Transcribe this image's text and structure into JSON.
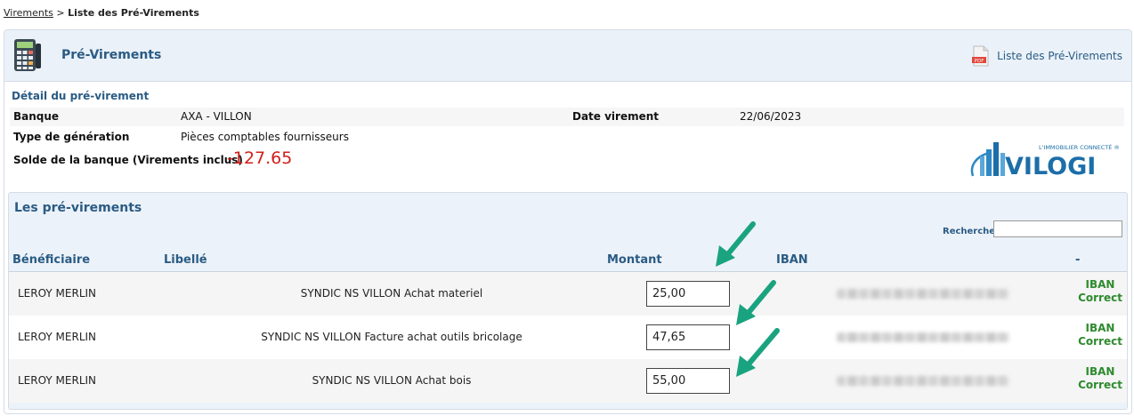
{
  "breadcrumb": {
    "parent": "Virements",
    "separator": ">",
    "current": "Liste des Pré-Virements"
  },
  "header": {
    "title": "Pré-Virements",
    "pdf_link": "Liste des Pré-Virements",
    "pdf_badge": "PDF"
  },
  "detail": {
    "section_title": "Détail du pré-virement",
    "banque_label": "Banque",
    "banque_value": "AXA - VILLON",
    "date_label": "Date virement",
    "date_value": "22/06/2023",
    "type_label": "Type de génération",
    "type_value": "Pièces comptables fournisseurs",
    "solde_label": "Solde de la banque (Virements inclus)",
    "solde_value": "-127.65"
  },
  "logo": {
    "tagline": "L'IMMOBILIER CONNECTÉ ®",
    "name": "VILOGI"
  },
  "list": {
    "title": "Les pré-virements",
    "search_label": "Rechercher",
    "search_value": "",
    "columns": [
      "Bénéficiaire",
      "Libellé",
      "Montant",
      "IBAN",
      "-"
    ],
    "rows": [
      {
        "beneficiaire": "LEROY MERLIN",
        "libelle": "SYNDIC NS VILLON Achat materiel",
        "montant": "25,00",
        "status_line1": "IBAN",
        "status_line2": "Correct"
      },
      {
        "beneficiaire": "LEROY MERLIN",
        "libelle": "SYNDIC NS VILLON Facture achat outils bricolage",
        "montant": "47,65",
        "status_line1": "IBAN",
        "status_line2": "Correct"
      },
      {
        "beneficiaire": "LEROY MERLIN",
        "libelle": "SYNDIC NS VILLON Achat bois",
        "montant": "55,00",
        "status_line1": "IBAN",
        "status_line2": "Correct"
      }
    ]
  },
  "colors": {
    "accent": "#2a5b84",
    "negative": "#d0201b",
    "ok": "#2e8b2e",
    "annotation_arrow": "#1aa37f"
  }
}
